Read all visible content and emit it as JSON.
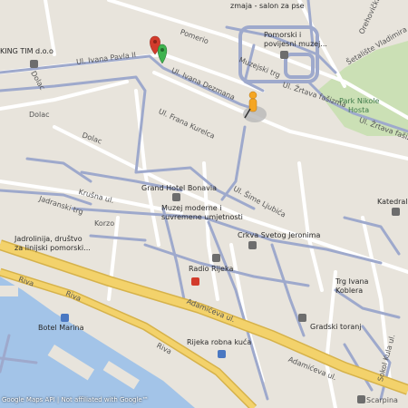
{
  "map": {
    "attribution_link": "Google Maps API",
    "attribution_separator": "|",
    "disclaimer": "Not affiliated with Google™",
    "colors": {
      "land": "#e8e4dc",
      "water": "#a3c4e8",
      "park": "#cbe0b5",
      "road": "#ffffff",
      "route": "#9ea9cc",
      "highway": "#f3d26b",
      "highway_edge": "#d6b24a"
    },
    "markers": [
      {
        "name": "red-pin-icon",
        "color": "#d23b2c"
      },
      {
        "name": "green-pin-icon",
        "color": "#3fb34f"
      },
      {
        "name": "pegman-icon",
        "color": "#f5a623"
      }
    ]
  },
  "labels": {
    "zmaja": "zmaja - salon za pse",
    "pomorski": "Pomorski i",
    "povijesni": "povijesni muzej...",
    "pomerio": "Pomerio",
    "muzejski_trg": "Muzejski trg",
    "ivana_pavla": "Ul. Ivana Pavla II",
    "ivana_dezmana": "Ul. Ivana Dezmana",
    "zrtava_fasizma": "Ul. Žrtava fašizma",
    "zrtava_fasizma_2": "Ul. Žrtava fašizma",
    "setaliste": "Šetalište Vladimira",
    "orehovica": "Orehovički put",
    "park_nikole": "Park Nikole",
    "hosta": "Hosta",
    "king_tim": "KING TIM d.o.o",
    "dolac_1": "Dolac",
    "dolac_2": "Dolac",
    "dolac_3": "Dolac",
    "frana_kurelca": "Ul. Frana Kurelca",
    "grand_hotel": "Grand Hotel Bonavia",
    "muzej_moderne": "Muzej moderne i",
    "suvremene": "suvremene umjetnosti",
    "sime_ljubica": "Ul. Šime Ljubića",
    "katedrala": "Katedrala",
    "krusna": "Krušna ul.",
    "jadranski_trg": "Jadranski trg",
    "korzo": "Korzo",
    "crkva": "Crkva Svetog Jeronima",
    "jadrolinija_1": "Jadrolinija, društvo",
    "jadrolinija_2": "za linijski pomorski...",
    "radio_rijeka": "Radio Rijeka",
    "riva_1": "Riva",
    "riva_2": "Riva",
    "riva_3": "Riva",
    "adamiceva_1": "Adamićeva ul.",
    "adamiceva_2": "Adamićeva ul.",
    "trg_ivana": "Trg Ivana",
    "koblera": "Koblera",
    "gradski_toranj": "Gradski toranj",
    "botel_marina": "Botel Marina",
    "robna_kuca": "Rijeka robna kuća",
    "sokol_kula": "Sokol Kula ul.",
    "scarpina": "Scarpina"
  }
}
